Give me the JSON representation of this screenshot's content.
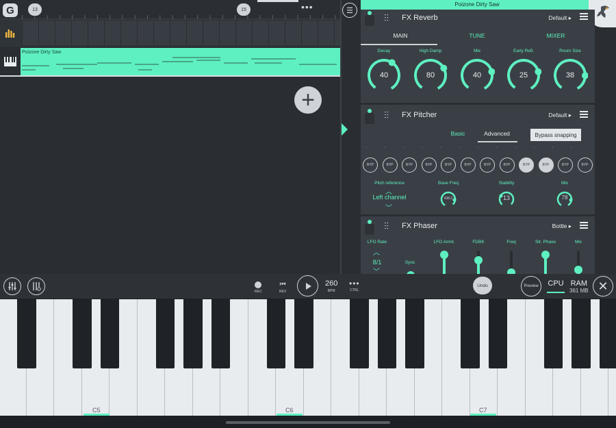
{
  "timeline": {
    "markers": [
      "13",
      "15"
    ],
    "more": "•••"
  },
  "tracks": [
    {
      "name": ""
    },
    {
      "name": "Poizone Dirty Saw"
    }
  ],
  "right_panel": {
    "title": "Poizone Dirty Saw"
  },
  "fx_reverb": {
    "name": "FX Reverb",
    "preset": "Default",
    "tabs": [
      "MAIN",
      "TUNE",
      "MIXER"
    ],
    "knobs": [
      {
        "label": "Decay",
        "value": "40",
        "level": 0.6
      },
      {
        "label": "High Damp",
        "value": "80",
        "level": 0.7
      },
      {
        "label": "Mix",
        "value": "40",
        "level": 0.75
      },
      {
        "label": "Early Refl.",
        "value": "25",
        "level": 0.75
      },
      {
        "label": "Room Size",
        "value": "38",
        "level": 0.8
      }
    ]
  },
  "fx_pitcher": {
    "name": "FX Pitcher",
    "preset": "Default",
    "tabs": [
      "Basic",
      "Advanced"
    ],
    "tooltip": "Bypass snapping",
    "byp_label": "BYP",
    "byp_states": [
      false,
      false,
      false,
      false,
      false,
      false,
      false,
      false,
      true,
      true,
      false,
      false
    ],
    "pitch_reference_label": "Pitch reference",
    "pitch_reference_value": "Left channel",
    "base_freq_label": "Base Freq",
    "base_freq_value": "438.0",
    "stability_label": "Stability",
    "stability_value": "13",
    "mix_label": "Mix",
    "mix_value": "78"
  },
  "fx_phaser": {
    "name": "FX Phaser",
    "preset": "Bottle",
    "lfo_rate_label": "LFO Rate",
    "lfo_rate_value": "8/1",
    "sync_label": "Sync",
    "sliders": [
      "LFO Amnt.",
      "FDBK",
      "Freq",
      "Str. Phase",
      "Mix"
    ]
  },
  "transport": {
    "rec": "REC",
    "rev": "REV",
    "bpm_value": "260",
    "bpm_label": "BPM",
    "ctrl": "CTRL",
    "undo": "Undo",
    "preview": "Preview",
    "cpu": "CPU",
    "ram": "RAM",
    "ram_value": "361 MB"
  },
  "keyboard": {
    "labels": [
      "C5",
      "C6",
      "C7"
    ]
  },
  "colors": {
    "accent": "#5ef0c0",
    "panel": "#3a3f46",
    "background": "#2a2e33"
  }
}
